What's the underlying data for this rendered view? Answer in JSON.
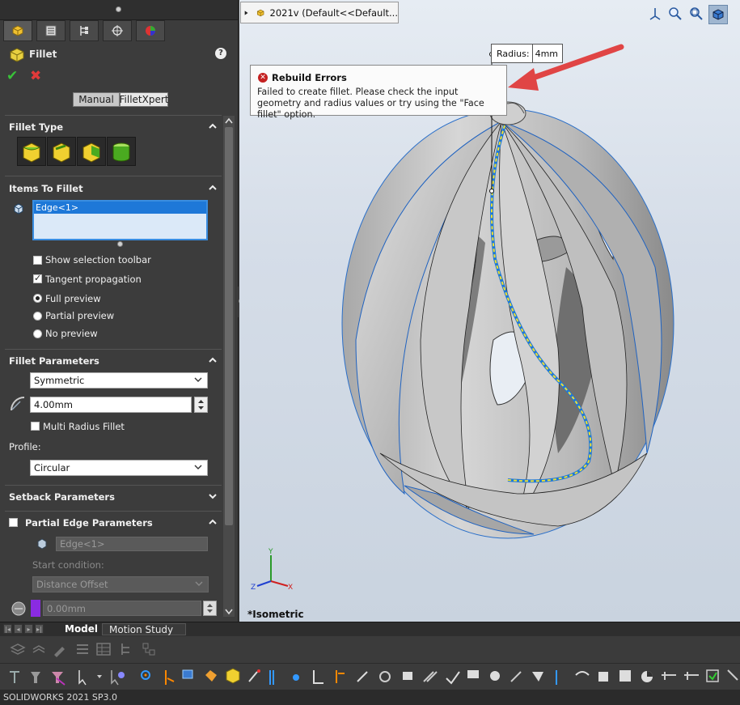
{
  "property_manager": {
    "feature_title": "Fillet",
    "help": "?",
    "mode_tabs": [
      "Manual",
      "FilletXpert"
    ],
    "active_mode": "Manual",
    "fillet_type": {
      "title": "Fillet Type"
    },
    "items_to_fillet": {
      "title": "Items To Fillet",
      "selected": [
        "Edge<1>"
      ],
      "show_selection_toolbar": "Show selection toolbar",
      "tangent_propagation": "Tangent propagation",
      "tangent_checked": true,
      "preview_options": [
        "Full preview",
        "Partial preview",
        "No preview"
      ],
      "preview_selected": "Full preview"
    },
    "fillet_parameters": {
      "title": "Fillet Parameters",
      "method": "Symmetric",
      "radius": "4.00mm",
      "multi_radius": "Multi Radius Fillet",
      "profile_label": "Profile:",
      "profile": "Circular"
    },
    "setback_parameters": {
      "title": "Setback Parameters"
    },
    "partial_edge": {
      "title": "Partial Edge Parameters",
      "edge": "Edge<1>",
      "start_condition_label": "Start condition:",
      "start_condition": "Distance Offset",
      "offset": "0.00mm"
    }
  },
  "viewport": {
    "tree_label": "2021v  (Default<<Default...",
    "radius_callout_label": "Radius:",
    "radius_callout_value": "4mm",
    "error": {
      "title": "Rebuild Errors",
      "message": "Failed to create fillet.  Please check the input geometry and radius values or try using the \"Face fillet\" option."
    },
    "view_name": "*Isometric",
    "triad_axes": [
      "X",
      "Y",
      "Z"
    ]
  },
  "bottom_tabs": [
    "Model",
    "Motion Study 1"
  ],
  "active_bottom_tab": "Model",
  "status_bar": "SOLIDWORKS 2021 SP3.0",
  "colors": {
    "panel_bg": "#3c3c3c",
    "accent_blue": "#1e78d8",
    "arrow_red": "#e04545",
    "selection_yellow": "#f0e030",
    "error_red": "#c42020"
  }
}
